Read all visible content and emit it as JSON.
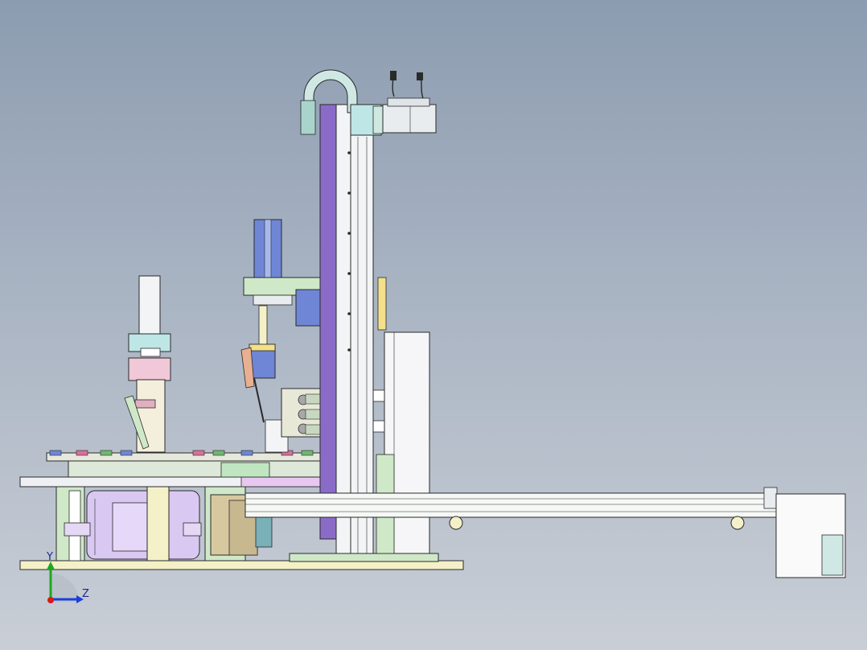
{
  "triad": {
    "y_label": "Y",
    "z_label": "Z",
    "y_color": "#1fa81f",
    "z_color": "#1a3fd8",
    "x_color": "#d81a1a"
  },
  "colors": {
    "background_top": "#8c9cb0",
    "background_bottom": "#c9ced6",
    "outline": "#2a2a2a",
    "purple_column": "#8a6cc8",
    "lavender_gearbox": "#d9c8f2",
    "pale_yellow": "#f4f0c8",
    "mint": "#cfe8c8",
    "pink": "#f0c8d8",
    "steel": "#e8ecef",
    "cyan": "#bfe6e6",
    "blue_block": "#6f86d6"
  },
  "components": [
    "base-plate",
    "rotary-table",
    "gearbox-left",
    "press-unit-left",
    "camera-unit",
    "vertical-column",
    "cable-chain-loop",
    "top-servo-motor",
    "horizontal-beam",
    "electrical-cabinet",
    "end-cabinet"
  ]
}
